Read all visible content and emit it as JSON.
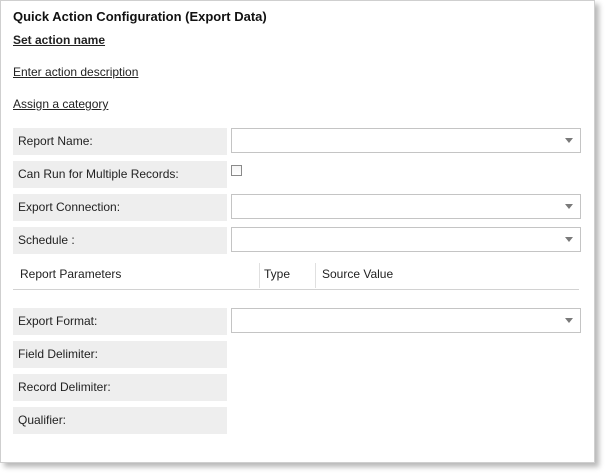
{
  "title": "Quick Action Configuration (Export Data)",
  "links": {
    "action_name": "Set action name",
    "action_description": "Enter action description",
    "category": "Assign a category"
  },
  "fields": {
    "report_name": {
      "label": "Report Name:",
      "value": ""
    },
    "multiple_records": {
      "label": "Can Run for Multiple Records:",
      "checked": false
    },
    "export_connection": {
      "label": "Export Connection:",
      "value": ""
    },
    "schedule": {
      "label": "Schedule :",
      "value": ""
    },
    "export_format": {
      "label": "Export Format:",
      "value": ""
    },
    "field_delimiter": {
      "label": "Field Delimiter:"
    },
    "record_delimiter": {
      "label": "Record Delimiter:"
    },
    "qualifier": {
      "label": "Qualifier:"
    }
  },
  "report_parameters": {
    "columns": [
      "Report Parameters",
      "Type",
      "Source Value"
    ],
    "rows": []
  }
}
